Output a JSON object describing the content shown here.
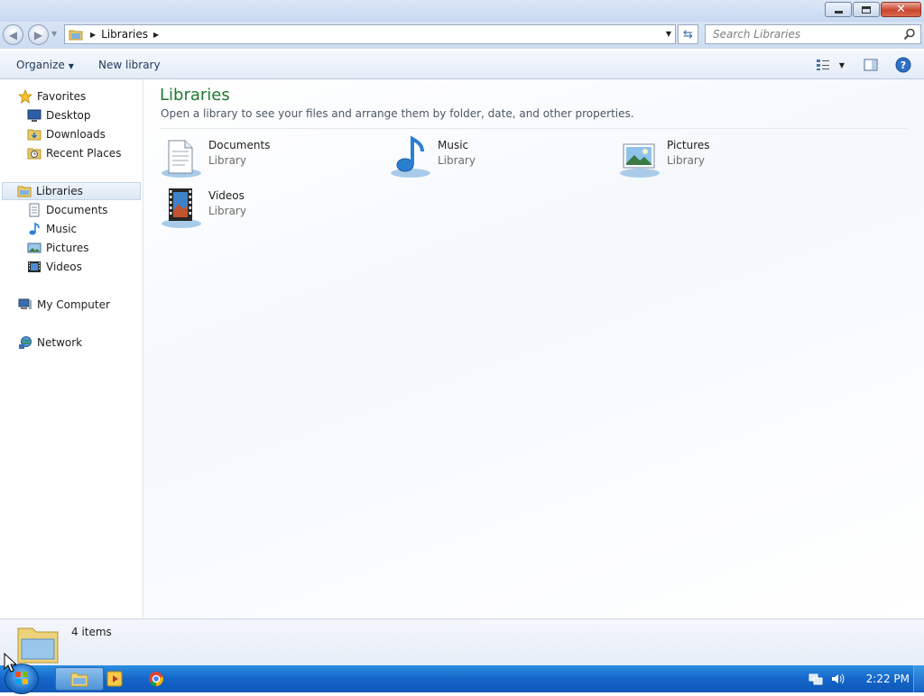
{
  "window": {
    "title_buttons": {
      "minimize": "minimize",
      "maximize": "maximize",
      "close": "close"
    }
  },
  "address": {
    "path": "Libraries",
    "search_placeholder": "Search Libraries"
  },
  "commands": {
    "organize": "Organize",
    "new_library": "New library"
  },
  "nav": {
    "favorites": {
      "label": "Favorites",
      "items": [
        {
          "label": "Desktop",
          "icon": "desktop-icon"
        },
        {
          "label": "Downloads",
          "icon": "downloads-icon"
        },
        {
          "label": "Recent Places",
          "icon": "recent-places-icon"
        }
      ]
    },
    "libraries": {
      "label": "Libraries",
      "items": [
        {
          "label": "Documents",
          "icon": "documents-icon"
        },
        {
          "label": "Music",
          "icon": "music-icon"
        },
        {
          "label": "Pictures",
          "icon": "pictures-icon"
        },
        {
          "label": "Videos",
          "icon": "videos-icon"
        }
      ]
    },
    "computer": "My Computer",
    "network": "Network"
  },
  "content": {
    "title": "Libraries",
    "subtitle": "Open a library to see your files and arrange them by folder, date, and other properties.",
    "libraries": [
      {
        "name": "Documents",
        "type": "Library",
        "icon": "documents-library-icon"
      },
      {
        "name": "Music",
        "type": "Library",
        "icon": "music-library-icon"
      },
      {
        "name": "Pictures",
        "type": "Library",
        "icon": "pictures-library-icon"
      },
      {
        "name": "Videos",
        "type": "Library",
        "icon": "videos-library-icon"
      }
    ]
  },
  "details": {
    "count": "4 items"
  },
  "taskbar": {
    "clock": "2:22 PM",
    "apps": [
      "windows-explorer",
      "media-player",
      "chrome"
    ]
  },
  "colors": {
    "title_green": "#1e7a2e",
    "taskbar_blue": "#1565c9"
  }
}
